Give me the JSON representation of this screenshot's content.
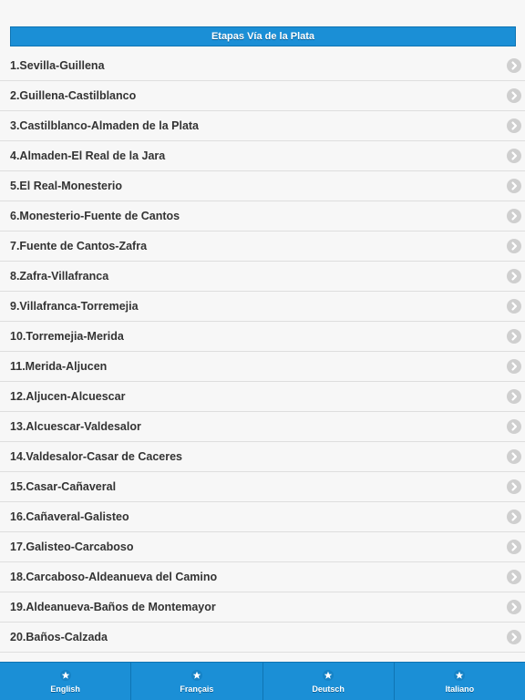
{
  "header": {
    "title": "Etapas Vía de la Plata"
  },
  "stages": [
    "1.Sevilla-Guillena",
    "2.Guillena-Castilblanco",
    "3.Castilblanco-Almaden de la Plata",
    "4.Almaden-El Real de la Jara",
    "5.El Real-Monesterio",
    "6.Monesterio-Fuente de Cantos",
    "7.Fuente de Cantos-Zafra",
    "8.Zafra-Villafranca",
    "9.Villafranca-Torremejia",
    "10.Torremejia-Merida",
    "11.Merida-Aljucen",
    "12.Aljucen-Alcuescar",
    "13.Alcuescar-Valdesalor",
    "14.Valdesalor-Casar de Caceres",
    "15.Casar-Cañaveral",
    "16.Cañaveral-Galisteo",
    "17.Galisteo-Carcaboso",
    "18.Carcaboso-Aldeanueva del Camino",
    "19.Aldeanueva-Baños de Montemayor",
    "20.Baños-Calzada"
  ],
  "row_icon": "chevron-right-circle-icon",
  "tabs": [
    {
      "label": "English",
      "icon": "star-icon"
    },
    {
      "label": "Français",
      "icon": "star-icon"
    },
    {
      "label": "Deutsch",
      "icon": "star-icon"
    },
    {
      "label": "Italiano",
      "icon": "star-icon"
    }
  ],
  "colors": {
    "accent": "#1b8fd6",
    "accent_border": "#0f74b3",
    "row_text": "#333333",
    "chevron_bg": "#cfcfcf"
  }
}
